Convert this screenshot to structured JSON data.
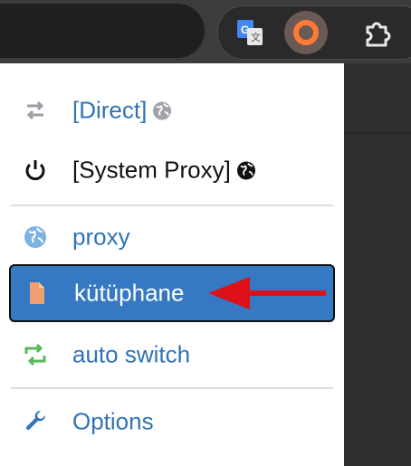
{
  "menu": {
    "items": [
      {
        "label": "[Direct]"
      },
      {
        "label": "[System Proxy]"
      },
      {
        "label": "proxy"
      },
      {
        "label": "kütüphane"
      },
      {
        "label": "auto switch"
      },
      {
        "label": "Options"
      }
    ],
    "selected_index": 3
  },
  "icons": {
    "toolbar": [
      "google-translate-icon",
      "switchyomega-icon",
      "extensions-puzzle-icon"
    ],
    "menu": [
      "direct-arrows-icon",
      "power-icon",
      "globe-icon",
      "file-icon",
      "switch-icon",
      "wrench-icon"
    ]
  },
  "colors": {
    "accent_blue": "#3479c2",
    "label_blue": "#2f73b8",
    "omega_orange": "#ff7a33",
    "arrow_red": "#e0101a",
    "switch_green": "#5cb85c",
    "file_orange": "#f0a070"
  }
}
